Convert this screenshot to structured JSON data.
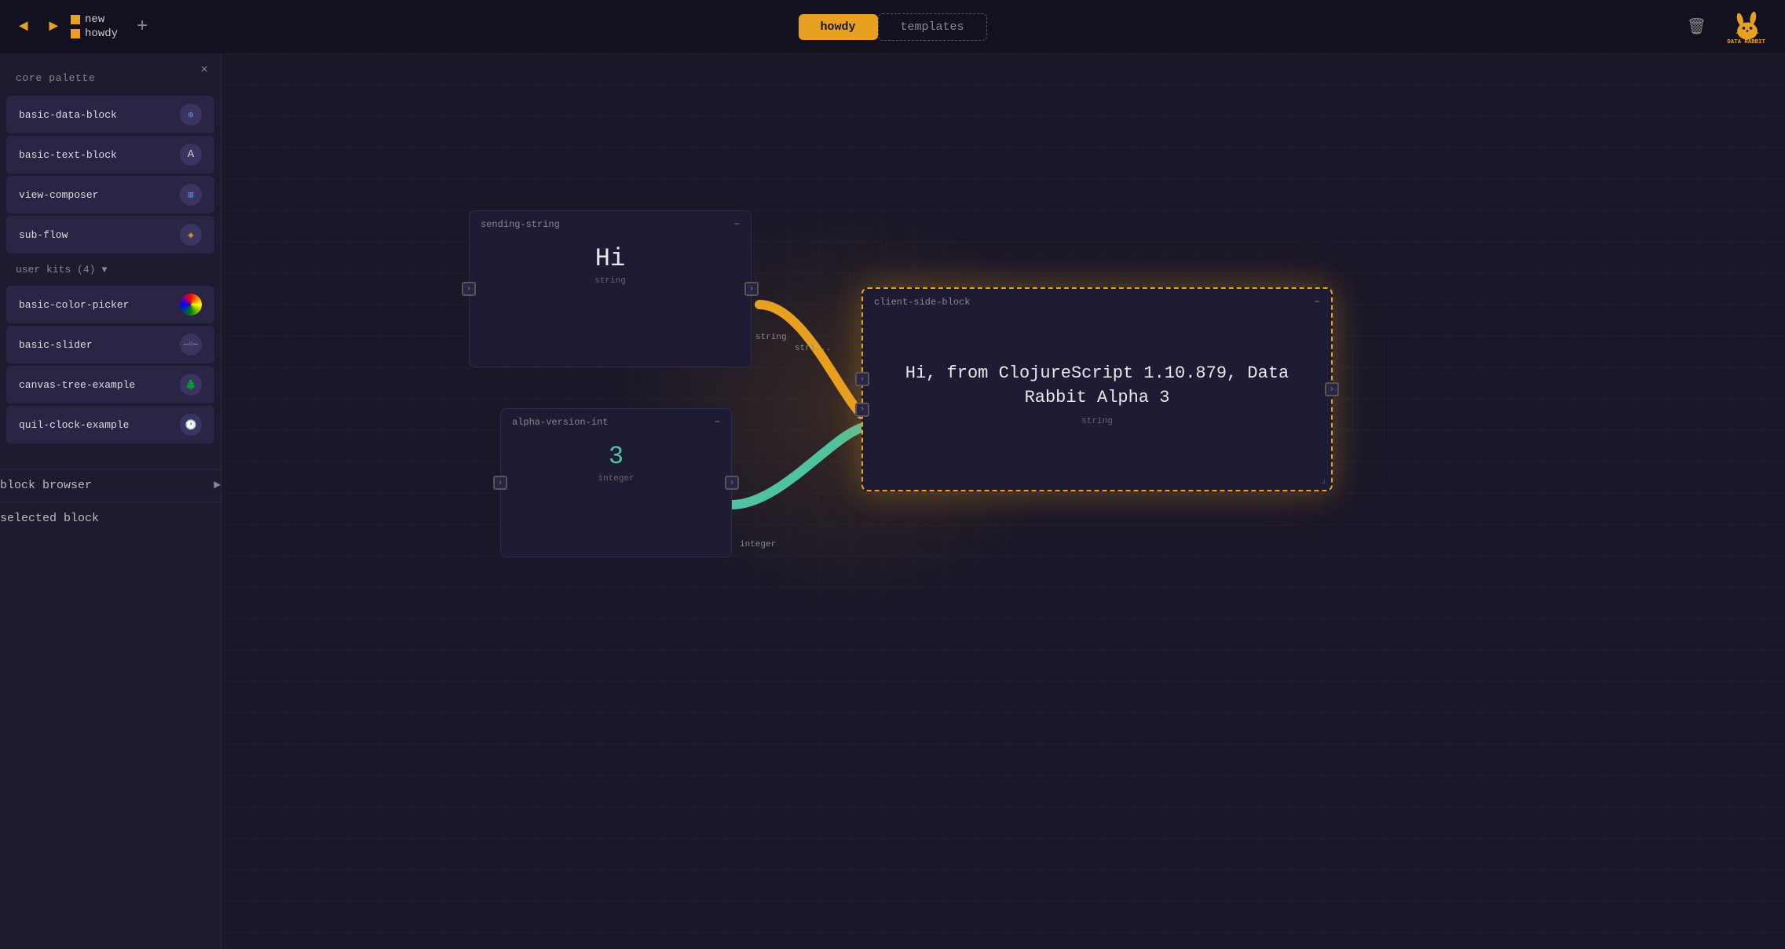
{
  "app": {
    "title": "Data Rabbit"
  },
  "topnav": {
    "back_arrow": "◄",
    "forward_arrow": "►",
    "file_new_icon": "■",
    "file_new_label": "new",
    "file_howdy_icon": "■",
    "file_howdy_label": "howdy",
    "add_button": "+",
    "tab_active": "howdy",
    "tab_inactive": "templates",
    "trash_icon": "🗑"
  },
  "sidebar": {
    "close_icon": "×",
    "section_title": "core palette",
    "palette_items": [
      {
        "label": "basic-data-block",
        "icon": "⊕",
        "icon_type": "data"
      },
      {
        "label": "basic-text-block",
        "icon": "A",
        "icon_type": "text"
      },
      {
        "label": "view-composer",
        "icon": "⊞",
        "icon_type": "view"
      },
      {
        "label": "sub-flow",
        "icon": "◈",
        "icon_type": "sub"
      }
    ],
    "user_kits_label": "user kits (4)",
    "user_kits_arrow": "▼",
    "user_kit_items": [
      {
        "label": "basic-color-picker",
        "icon": "◑"
      },
      {
        "label": "basic-slider",
        "icon": "—○—"
      },
      {
        "label": "canvas-tree-example",
        "icon": "🌲"
      },
      {
        "label": "quil-clock-example",
        "icon": "🕐"
      }
    ],
    "block_browser_label": "block browser",
    "block_browser_arrow": "►",
    "selected_block_label": "selected block"
  },
  "canvas": {
    "blocks": {
      "sending_string": {
        "title": "sending-string",
        "value": "Hi",
        "type": "string",
        "min_button": "−"
      },
      "alpha_version": {
        "title": "alpha-version-int",
        "value": "3",
        "type": "integer",
        "min_button": "−"
      },
      "client_side": {
        "title": "client-side-block",
        "value": "Hi, from ClojureScript 1.10.879, Data Rabbit Alpha 3",
        "type": "string",
        "min_button": "−"
      }
    },
    "connection_labels": {
      "string_out": "string",
      "integer_out": "integer",
      "string_in": "stri..."
    }
  }
}
